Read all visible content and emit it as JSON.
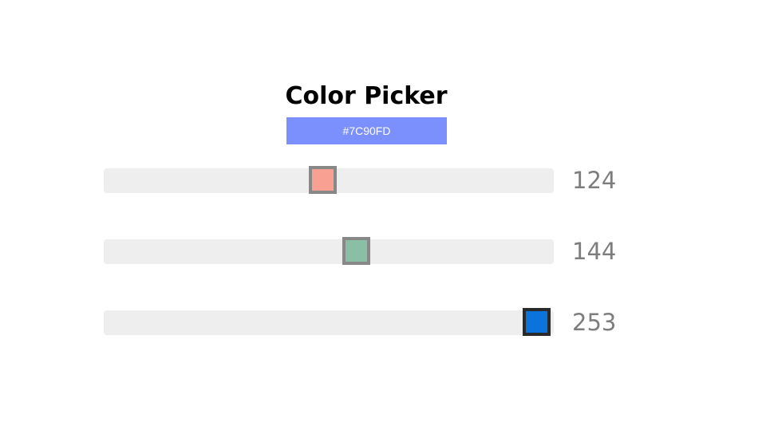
{
  "title": "Color Picker",
  "hex": {
    "text": "#7C90FD",
    "color": "#7C90FD"
  },
  "sliders": [
    {
      "channel": "red",
      "value": "124",
      "fraction": 0.486,
      "thumb_color": "#F8A092",
      "thumb_border": "#888888",
      "active": false
    },
    {
      "channel": "green",
      "value": "144",
      "fraction": 0.565,
      "thumb_color": "#8ABFA6",
      "thumb_border": "#888888",
      "active": false
    },
    {
      "channel": "blue",
      "value": "253",
      "fraction": 0.992,
      "thumb_color": "#0A73DC",
      "thumb_border": "#2A2A2A",
      "active": true
    }
  ]
}
